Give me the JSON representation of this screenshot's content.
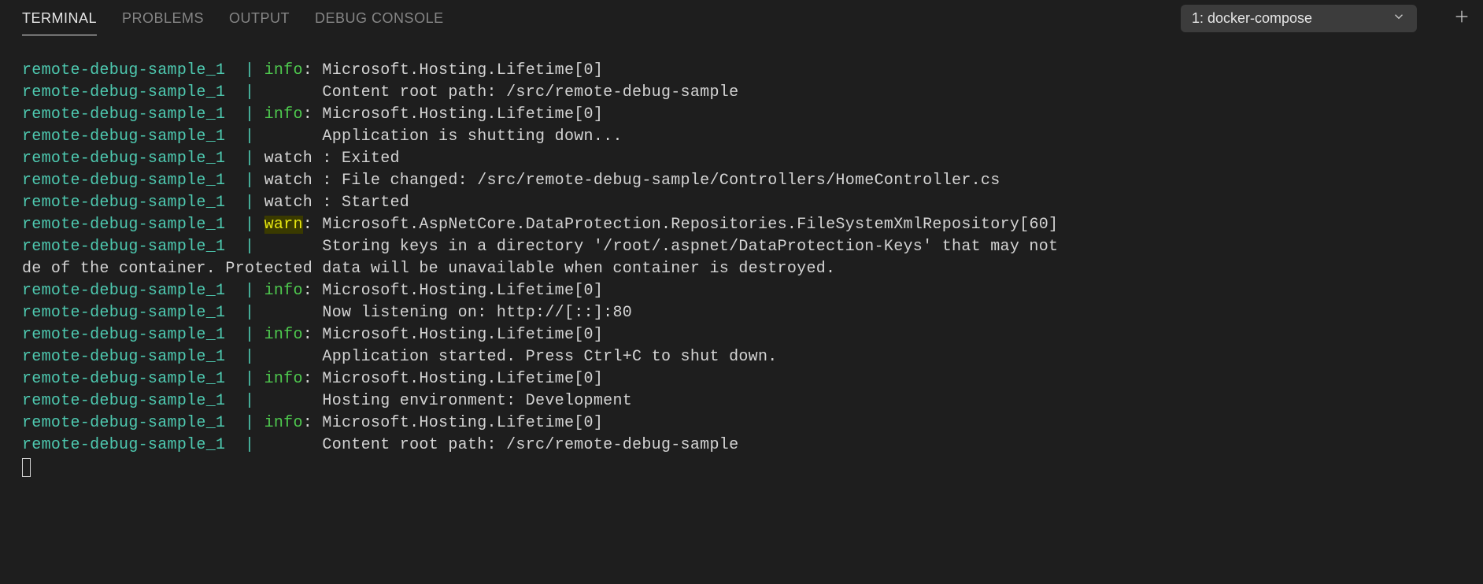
{
  "tabs": {
    "terminal": "TERMINAL",
    "problems": "PROBLEMS",
    "output": "OUTPUT",
    "debug_console": "DEBUG CONSOLE"
  },
  "dropdown": {
    "label": "1: docker-compose"
  },
  "terminal": {
    "prefix": "remote-debug-sample_1",
    "lines": [
      {
        "type": "info",
        "tag": "info",
        "msg": ": Microsoft.Hosting.Lifetime[0]"
      },
      {
        "type": "cont",
        "msg": "      Content root path: /src/remote-debug-sample"
      },
      {
        "type": "info",
        "tag": "info",
        "msg": ": Microsoft.Hosting.Lifetime[0]"
      },
      {
        "type": "cont",
        "msg": "      Application is shutting down..."
      },
      {
        "type": "plain",
        "msg": "watch : Exited"
      },
      {
        "type": "plain",
        "msg": "watch : File changed: /src/remote-debug-sample/Controllers/HomeController.cs"
      },
      {
        "type": "plain",
        "msg": "watch : Started"
      },
      {
        "type": "warn",
        "tag": "warn",
        "msg": ": Microsoft.AspNetCore.DataProtection.Repositories.FileSystemXmlRepository[60]"
      },
      {
        "type": "cont",
        "msg": "      Storing keys in a directory '/root/.aspnet/DataProtection-Keys' that may not "
      },
      {
        "type": "wrap",
        "msg": "de of the container. Protected data will be unavailable when container is destroyed."
      },
      {
        "type": "info",
        "tag": "info",
        "msg": ": Microsoft.Hosting.Lifetime[0]"
      },
      {
        "type": "cont",
        "msg": "      Now listening on: http://[::]:80"
      },
      {
        "type": "info",
        "tag": "info",
        "msg": ": Microsoft.Hosting.Lifetime[0]"
      },
      {
        "type": "cont",
        "msg": "      Application started. Press Ctrl+C to shut down."
      },
      {
        "type": "info",
        "tag": "info",
        "msg": ": Microsoft.Hosting.Lifetime[0]"
      },
      {
        "type": "cont",
        "msg": "      Hosting environment: Development"
      },
      {
        "type": "info",
        "tag": "info",
        "msg": ": Microsoft.Hosting.Lifetime[0]"
      },
      {
        "type": "cont",
        "msg": "      Content root path: /src/remote-debug-sample"
      }
    ]
  }
}
